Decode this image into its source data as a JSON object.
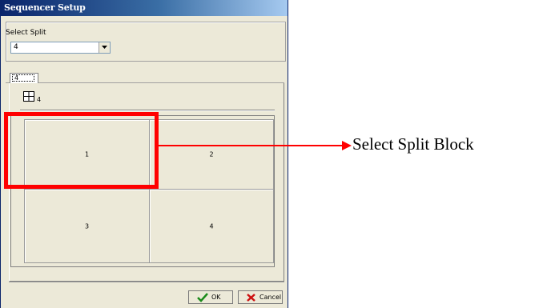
{
  "window": {
    "title": "Sequencer Setup"
  },
  "select_split": {
    "label": "Select Split",
    "value": "4"
  },
  "tab": {
    "label": "4"
  },
  "split_layout": {
    "count_label": "4"
  },
  "cells": [
    "1",
    "2",
    "3",
    "4"
  ],
  "buttons": {
    "ok": "OK",
    "cancel": "Cancel"
  },
  "annotation": {
    "text": "Select Split Block"
  },
  "colors": {
    "highlight": "#ff0000",
    "title_bar": "#0a246a",
    "dialog_bg": "#ece9d8"
  }
}
